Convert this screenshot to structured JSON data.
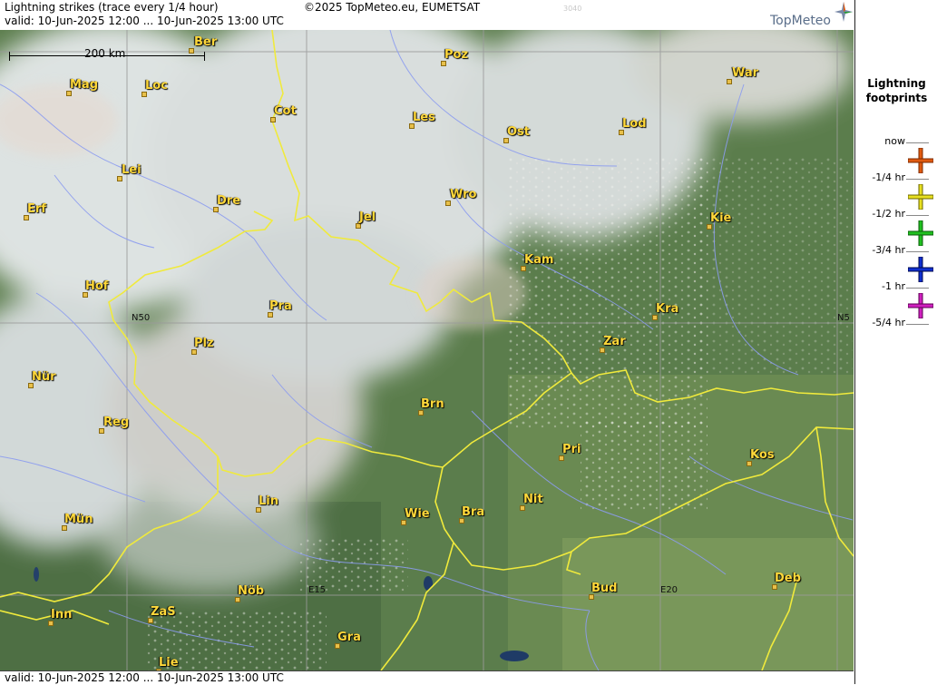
{
  "header": {
    "title": "Lightning strikes (trace every 1/4 hour)",
    "copyright": "©2025 TopMeteo.eu, EUMETSAT",
    "code": "3040",
    "valid": "valid:  10-Jun-2025 12:00 ... 10-Jun-2025 13:00 UTC",
    "brand": "TopMeteo"
  },
  "footer": {
    "valid": "valid:  10-Jun-2025 12:00 ... 10-Jun-2025 13:00 UTC"
  },
  "scale": {
    "label": "200 km"
  },
  "grid_labels": {
    "n50_left": "N50",
    "n50_right": "N5",
    "e15": "E15",
    "e20": "E20"
  },
  "cities": [
    {
      "id": "ber",
      "name": "Ber"
    },
    {
      "id": "poz",
      "name": "Poz"
    },
    {
      "id": "war",
      "name": "War"
    },
    {
      "id": "mag",
      "name": "Mag"
    },
    {
      "id": "loc",
      "name": "Loc"
    },
    {
      "id": "cot",
      "name": "Cot"
    },
    {
      "id": "les",
      "name": "Les"
    },
    {
      "id": "lod",
      "name": "Lod"
    },
    {
      "id": "ost",
      "name": "Ost"
    },
    {
      "id": "lei",
      "name": "Lei"
    },
    {
      "id": "wro",
      "name": "Wro"
    },
    {
      "id": "erf",
      "name": "Erf"
    },
    {
      "id": "dre",
      "name": "Dre"
    },
    {
      "id": "jel",
      "name": "Jel"
    },
    {
      "id": "kie",
      "name": "Kie"
    },
    {
      "id": "kam",
      "name": "Kam"
    },
    {
      "id": "hof",
      "name": "Hof"
    },
    {
      "id": "pra",
      "name": "Pra"
    },
    {
      "id": "kra",
      "name": "Kra"
    },
    {
      "id": "plz",
      "name": "Plz"
    },
    {
      "id": "zar",
      "name": "Zar"
    },
    {
      "id": "nur",
      "name": "Nür"
    },
    {
      "id": "brn",
      "name": "Brn"
    },
    {
      "id": "reg",
      "name": "Reg"
    },
    {
      "id": "pri",
      "name": "Pri"
    },
    {
      "id": "kos",
      "name": "Kos"
    },
    {
      "id": "lin",
      "name": "Lin"
    },
    {
      "id": "nit",
      "name": "Nit"
    },
    {
      "id": "bra",
      "name": "Bra"
    },
    {
      "id": "wie",
      "name": "Wie"
    },
    {
      "id": "mun",
      "name": "Mün"
    },
    {
      "id": "nob",
      "name": "Nöb"
    },
    {
      "id": "bud",
      "name": "Bud"
    },
    {
      "id": "deb",
      "name": "Deb"
    },
    {
      "id": "inn",
      "name": "Inn"
    },
    {
      "id": "zas",
      "name": "ZaS"
    },
    {
      "id": "gra",
      "name": "Gra"
    },
    {
      "id": "lie",
      "name": "Lie"
    }
  ],
  "legend": {
    "title_line1": "Lightning",
    "title_line2": "footprints",
    "items": [
      {
        "label": "now",
        "color": "#e05a10"
      },
      {
        "label": "-1/4 hr",
        "color": "#e8e020"
      },
      {
        "label": "-1/2 hr",
        "color": "#20c020"
      },
      {
        "label": "-3/4 hr",
        "color": "#1030d0"
      },
      {
        "label": "-1 hr",
        "color": "#d020c0"
      },
      {
        "label": "-5/4 hr",
        "color": ""
      }
    ]
  },
  "colors": {
    "border": "#f0ea3c",
    "river": "#8c9cf0",
    "grid": "#9a9a9a",
    "city_text": "#ffd83a"
  }
}
